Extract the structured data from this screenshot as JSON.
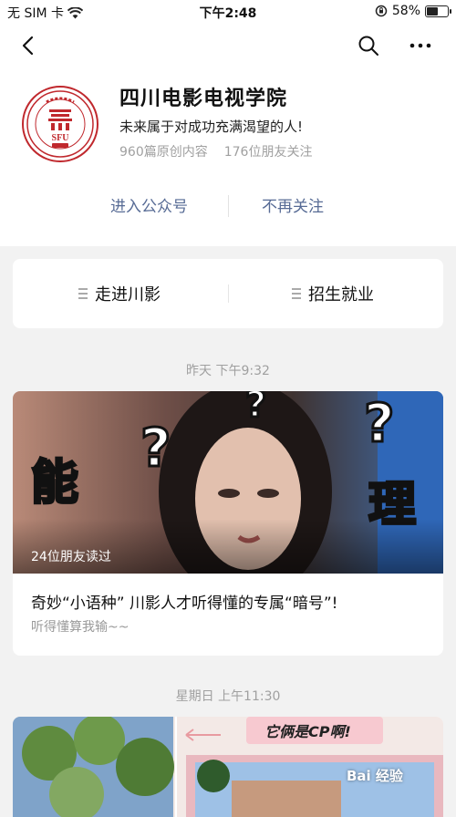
{
  "status_bar": {
    "carrier": "无 SIM 卡",
    "time": "下午2:48",
    "battery": "58%"
  },
  "account": {
    "name": "四川电影电视学院",
    "slogan": "未来属于对成功充满渴望的人!",
    "original_count": "960篇原创内容",
    "friends_following": "176位朋友关注",
    "logo_text": "SFU",
    "follow_action": "进入公众号",
    "unfollow_action": "不再关注"
  },
  "menu": {
    "items": [
      {
        "label": "走进川影"
      },
      {
        "label": "招生就业"
      }
    ]
  },
  "feed": [
    {
      "timestamp": "昨天 下午9:32",
      "cover_words": [
        "能",
        "理"
      ],
      "read_count": "24位朋友读过",
      "title": "奇妙“小语种” 川影人才听得懂的专属“暗号”!",
      "digest": "听得懂算我输~~"
    },
    {
      "timestamp": "星期日 上午11:30",
      "cover_caption": "它俩是CP啊!"
    }
  ],
  "watermark": "Bai 经验",
  "colors": {
    "link": "#576b95",
    "logo_red": "#c0282d"
  }
}
